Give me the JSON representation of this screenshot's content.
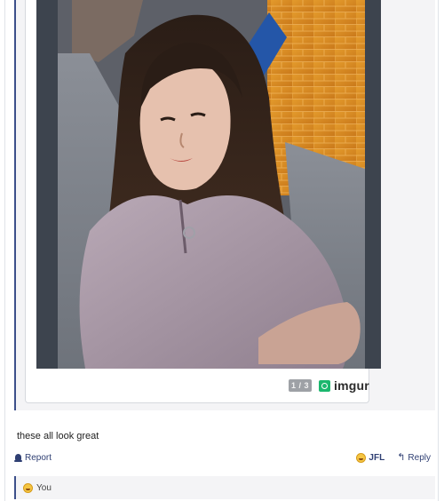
{
  "embed": {
    "pager": "1 / 3",
    "provider": "imgur"
  },
  "post": {
    "text": "these all look great"
  },
  "actions": {
    "report_label": "Report",
    "reactor_name": "JFL",
    "reply_label": "Reply"
  },
  "reactions": {
    "label": "You"
  },
  "icons": {
    "report": "bell-icon",
    "reactor": "laughing-emoji-icon",
    "reply": "reply-arrow-icon",
    "provider": "imgur-logo-icon"
  },
  "colors": {
    "accent": "#2f3f73",
    "quote_border": "#3c4f8a",
    "imgur_green": "#1bb76e"
  }
}
